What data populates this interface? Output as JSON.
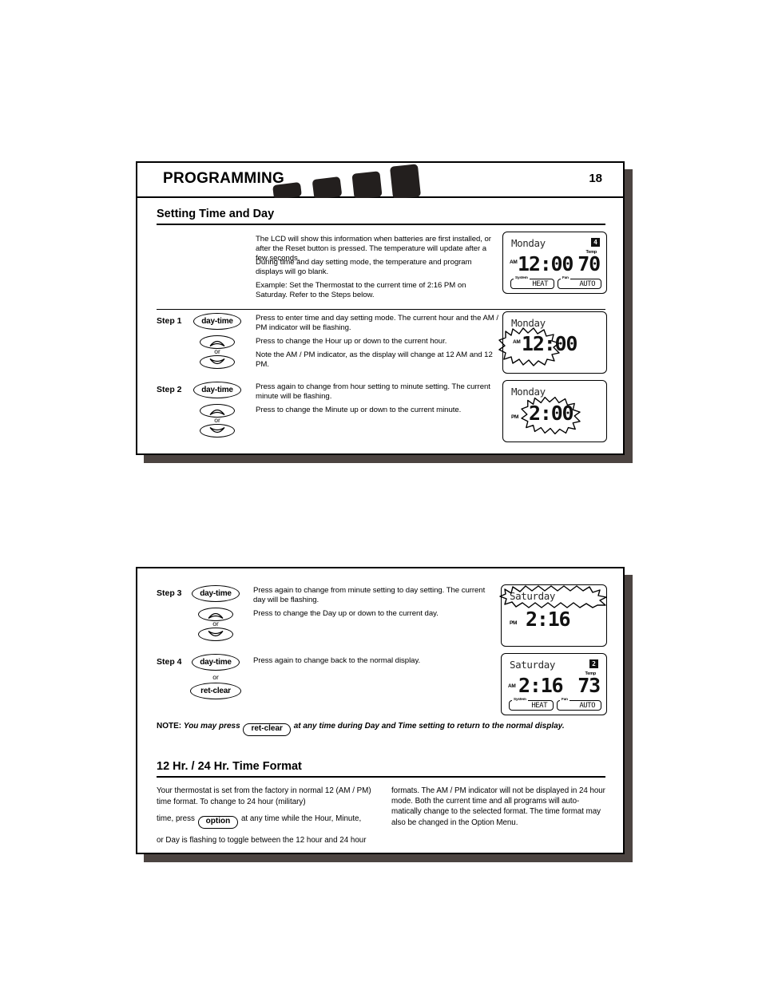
{
  "header": {
    "title": "PROGRAMMING",
    "page_number": "18"
  },
  "sections": {
    "setting_time_day": {
      "heading": "Setting Time and Day",
      "intro_paragraphs": [
        "The LCD will show this information when batteries are first installed, or after the Reset button is pressed. The temperature will update after a few seconds.",
        "During time and day setting mode, the temperature and program displays will go blank.",
        "Example: Set the Thermostat to the current time of 2:16 PM on Saturday. Refer to the Steps below."
      ]
    },
    "time_format": {
      "heading": "12 Hr. / 24 Hr. Time Format",
      "col_left_pre": "Your thermostat is set from the factory in normal 12 (AM / PM) time format. To change to 24 hour (military)",
      "col_left_mid_pre": "time, press",
      "col_left_button": "option",
      "col_left_mid_post": "at any time while the Hour, Minute,",
      "col_left_post": "or Day is flashing to toggle between the 12 hour and 24 hour",
      "col_right": "formats. The AM / PM indicator will not be displayed in 24 hour mode. Both the current time and all programs will auto-matically change to the selected format. The time format may also be changed in the Option Menu."
    }
  },
  "note": {
    "prefix": "NOTE:",
    "text_before": "You may press",
    "button": "ret-clear",
    "text_after": "at any time during Day and Time setting to return to the normal display."
  },
  "buttons": {
    "day_time": "day-time",
    "ret_clear": "ret-clear",
    "option": "option",
    "or": "or",
    "up_arrow_icon": "up-arrow-icon",
    "down_arrow_icon": "down-arrow-icon"
  },
  "steps": [
    {
      "label": "Step 1",
      "paragraphs": [
        "Press to enter time and day setting mode. The current hour and the AM / PM indicator will be flashing.",
        "Press to change the Hour up or down to the current hour.",
        "Note the AM / PM indicator, as the display will change at 12 AM and 12 PM."
      ]
    },
    {
      "label": "Step 2",
      "paragraphs": [
        "Press again to change from hour setting to minute setting. The current minute will be flashing.",
        "Press to change the Minute up or down to the current minute."
      ]
    },
    {
      "label": "Step 3",
      "paragraphs": [
        "Press again to change from minute setting to day setting. The current day will be flashing.",
        "Press to change the Day up or down to the current day."
      ]
    },
    {
      "label": "Step 4",
      "paragraphs": [
        "Press again to change back to the normal display."
      ]
    }
  ],
  "lcd_displays": {
    "intro": {
      "day": "Monday",
      "badge": "4",
      "temp_label": "Temp",
      "ampm": "AM",
      "time": "12:00",
      "temperature": "70",
      "system_label": "System",
      "system_value": "HEAT",
      "fan_label": "Fan",
      "fan_value": "AUTO"
    },
    "step1": {
      "day": "Monday",
      "ampm": "AM",
      "time": "12:00",
      "flash_target": "hour-and-ampm"
    },
    "step2": {
      "day": "Monday",
      "ampm": "PM",
      "time": "2:00",
      "flash_target": "minutes"
    },
    "step3": {
      "day": "Saturday",
      "ampm": "PM",
      "time": "2:16",
      "flash_target": "day"
    },
    "step4": {
      "day": "Saturday",
      "badge": "2",
      "temp_label": "Temp",
      "ampm": "AM",
      "time": "2:16",
      "temperature": "73",
      "system_label": "System",
      "system_value": "HEAT",
      "fan_label": "Fan",
      "fan_value": "AUTO"
    }
  },
  "colors": {
    "ink": "#000000",
    "shadow": "#4c4441",
    "block": "#231f1e"
  }
}
